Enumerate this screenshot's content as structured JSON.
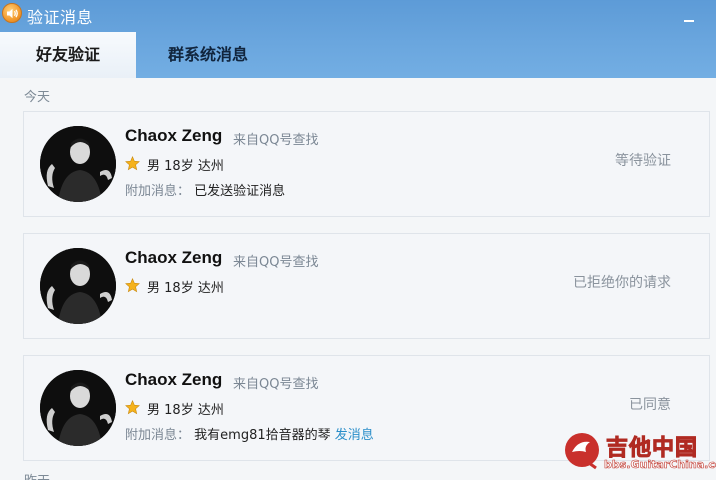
{
  "window": {
    "title": "验证消息"
  },
  "tabs": [
    {
      "label": "好友验证",
      "active": true
    },
    {
      "label": "群系统消息",
      "active": false
    }
  ],
  "sections": {
    "today": "今天",
    "yesterday": "昨天"
  },
  "requests": [
    {
      "name": "Chaox Zeng",
      "source": "来自QQ号查找",
      "gender": "男",
      "age": "18岁",
      "city": "达州",
      "extra_label": "附加消息：",
      "extra_message": "已发送验证消息",
      "status": "等待验证"
    },
    {
      "name": "Chaox Zeng",
      "source": "来自QQ号查找",
      "gender": "男",
      "age": "18岁",
      "city": "达州",
      "status": "已拒绝你的请求"
    },
    {
      "name": "Chaox Zeng",
      "source": "来自QQ号查找",
      "gender": "男",
      "age": "18岁",
      "city": "达州",
      "extra_label": "附加消息：",
      "extra_message": "我有emg81拾音器的琴",
      "extra_link": "发消息",
      "status": "已同意"
    }
  ],
  "watermark": {
    "name": "吉他中国",
    "url": "bbs.GuitarChina.com"
  },
  "colors": {
    "header": "#5d9bd7",
    "link": "#2a8ec9",
    "status": "#8a939d"
  },
  "icons": {
    "app": "speaker-icon",
    "level": "star-icon",
    "minimize": "minimize-icon"
  }
}
